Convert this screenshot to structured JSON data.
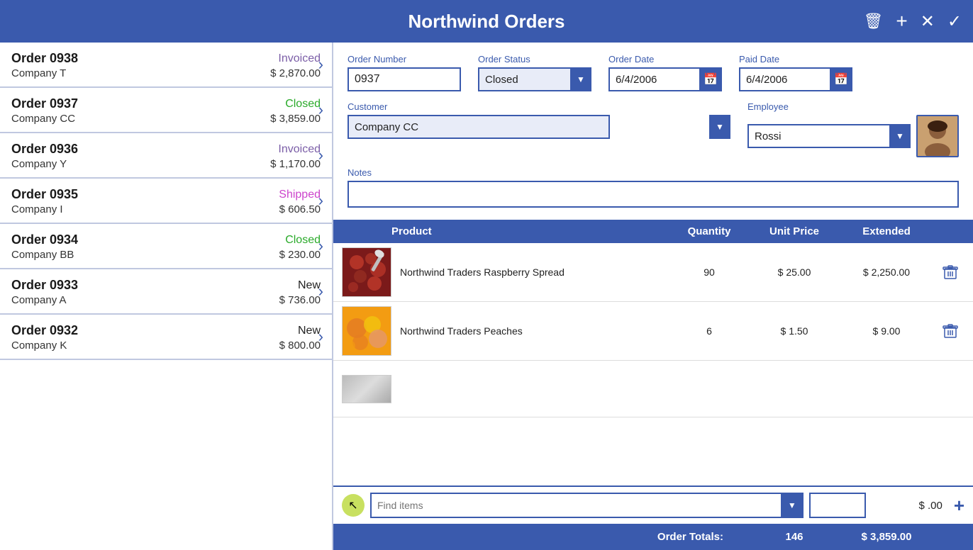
{
  "header": {
    "title": "Northwind Orders",
    "icons": {
      "delete": "🗑",
      "add": "+",
      "close": "✕",
      "confirm": "✓"
    }
  },
  "orders": [
    {
      "id": "0938",
      "company": "Company T",
      "status": "Invoiced",
      "statusClass": "status-invoiced",
      "amount": "$ 2,870.00"
    },
    {
      "id": "0937",
      "company": "Company CC",
      "status": "Closed",
      "statusClass": "status-closed",
      "amount": "$ 3,859.00"
    },
    {
      "id": "0936",
      "company": "Company Y",
      "status": "Invoiced",
      "statusClass": "status-invoiced",
      "amount": "$ 1,170.00"
    },
    {
      "id": "0935",
      "company": "Company I",
      "status": "Shipped",
      "statusClass": "status-shipped",
      "amount": "$ 606.50"
    },
    {
      "id": "0934",
      "company": "Company BB",
      "status": "Closed",
      "statusClass": "status-closed",
      "amount": "$ 230.00"
    },
    {
      "id": "0933",
      "company": "Company A",
      "status": "New",
      "statusClass": "status-new",
      "amount": "$ 736.00"
    },
    {
      "id": "0932",
      "company": "Company K",
      "status": "New",
      "statusClass": "status-new",
      "amount": "$ 800.00"
    }
  ],
  "form": {
    "order_number_label": "Order Number",
    "order_number_value": "0937",
    "order_status_label": "Order Status",
    "order_status_value": "Closed",
    "order_date_label": "Order Date",
    "order_date_value": "6/4/2006",
    "paid_date_label": "Paid Date",
    "paid_date_value": "6/4/2006",
    "customer_label": "Customer",
    "customer_value": "Company CC",
    "employee_label": "Employee",
    "employee_value": "Rossi",
    "notes_label": "Notes",
    "notes_value": ""
  },
  "products_table": {
    "headers": {
      "product": "Product",
      "quantity": "Quantity",
      "unit_price": "Unit Price",
      "extended": "Extended"
    },
    "rows": [
      {
        "name": "Northwind Traders Raspberry Spread",
        "type": "raspberry",
        "quantity": "90",
        "unit_price": "$ 25.00",
        "extended": "$ 2,250.00"
      },
      {
        "name": "Northwind Traders Peaches",
        "type": "peach",
        "quantity": "6",
        "unit_price": "$ 1.50",
        "extended": "$ 9.00"
      },
      {
        "name": "...",
        "type": "partial",
        "quantity": "",
        "unit_price": "",
        "extended": ""
      }
    ]
  },
  "add_row": {
    "find_items_placeholder": "Find items",
    "qty_value": "",
    "price_display": "$ .00",
    "add_label": "+"
  },
  "totals": {
    "label": "Order Totals:",
    "quantity": "146",
    "amount": "$ 3,859.00"
  }
}
